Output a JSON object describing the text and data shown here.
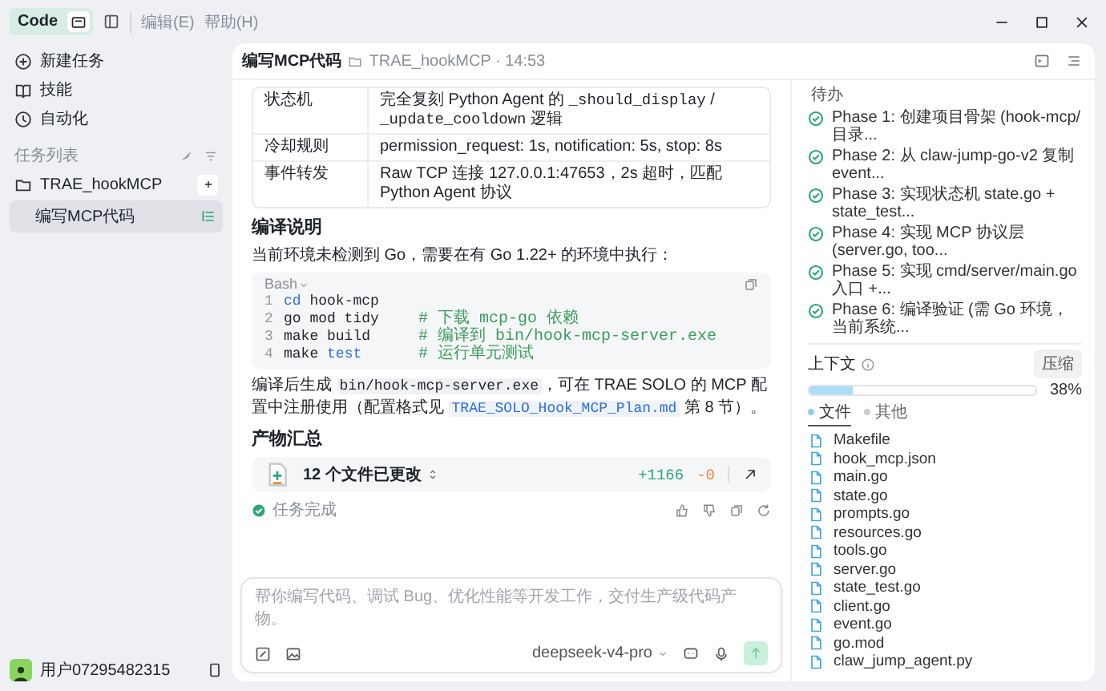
{
  "titlebar": {
    "mode": {
      "label": "Code",
      "on": true
    },
    "menus": [
      "编辑(E)",
      "帮助(H)"
    ]
  },
  "sidebar": {
    "nav": [
      {
        "label": "新建任务",
        "kind": "new"
      },
      {
        "label": "技能",
        "kind": "book"
      },
      {
        "label": "自动化",
        "kind": "clock"
      }
    ],
    "section_title": "任务列表",
    "projects": [
      {
        "name": "TRAE_hookMCP",
        "tasks": [
          {
            "label": "编写MCP代码",
            "selected": true
          }
        ]
      }
    ],
    "user": {
      "name": "用户07295482315"
    }
  },
  "task_header": {
    "title": "编写MCP代码",
    "meta": "TRAE_hookMCP · 14:53"
  },
  "chat": {
    "blocks": [
      {
        "kind": "table",
        "rows": [
          {
            "label": "状态机",
            "value": [
              {
                "kind": "text",
                "text": "完全复刻 Python Agent 的 "
              },
              {
                "kind": "mono",
                "text": "_should_display"
              },
              {
                "kind": "text",
                "text": " / "
              },
              {
                "kind": "mono",
                "text": "_update_cooldown"
              },
              {
                "kind": "text",
                "text": " 逻辑"
              }
            ]
          },
          {
            "label": "冷却规则",
            "value": [
              {
                "kind": "text",
                "text": "permission_request: 1s, notification: 5s, stop: 8s"
              }
            ]
          },
          {
            "label": "事件转发",
            "value": [
              {
                "kind": "text",
                "text": "Raw TCP 连接 127.0.0.1:47653，2s 超时，匹配 Python Agent 协议"
              }
            ]
          }
        ]
      },
      {
        "kind": "heading",
        "text": "编译说明"
      },
      {
        "kind": "paragraph",
        "segments": [
          {
            "kind": "text",
            "text": "当前环境未检测到 Go，需要在有 Go 1.22+ 的环境中执行："
          }
        ]
      },
      {
        "kind": "code",
        "language": "Bash",
        "lines": [
          {
            "number": "1",
            "tokens": [
              {
                "kind": "keyword",
                "text": "cd"
              },
              {
                "kind": "plain",
                "text": " hook-mcp"
              }
            ]
          },
          {
            "number": "2",
            "tokens": [
              {
                "kind": "plain",
                "text": "go mod tidy"
              },
              {
                "kind": "comment",
                "text": "# 下载 mcp-go 依赖"
              }
            ]
          },
          {
            "number": "3",
            "tokens": [
              {
                "kind": "plain",
                "text": "make build"
              },
              {
                "kind": "comment",
                "text": "# 编译到 bin/hook-mcp-server.exe"
              }
            ]
          },
          {
            "number": "4",
            "tokens": [
              {
                "kind": "plain",
                "text": "make "
              },
              {
                "kind": "keyword",
                "text": "test"
              },
              {
                "kind": "comment",
                "text": "# 运行单元测试"
              }
            ]
          }
        ]
      },
      {
        "kind": "paragraph",
        "segments": [
          {
            "kind": "text",
            "text": "编译后生成 "
          },
          {
            "kind": "code",
            "text": "bin/hook-mcp-server.exe"
          },
          {
            "kind": "text",
            "text": "，可在 TRAE SOLO 的 MCP 配置中注册使用（配置格式见 "
          },
          {
            "kind": "link",
            "text": "TRAE_SOLO_Hook_MCP_Plan.md"
          },
          {
            "kind": "text",
            "text": " 第 8 节）。"
          }
        ]
      },
      {
        "kind": "heading",
        "text": "产物汇总"
      },
      {
        "kind": "changes",
        "label": "12 个文件已更改",
        "added": "+1166",
        "removed": "-0"
      },
      {
        "kind": "status",
        "label": "任务完成",
        "done": true
      }
    ]
  },
  "input": {
    "placeholder": "帮你编写代码、调试 Bug、优化性能等开发工作，交付生产级代码产物。",
    "model": "deepseek-v4-pro"
  },
  "panel": {
    "todo": {
      "title": "待办",
      "items": [
        {
          "text": "Phase 1: 创建项目骨架 (hook-mcp/ 目录...",
          "done": true
        },
        {
          "text": "Phase 2: 从 claw-jump-go-v2 复制 event...",
          "done": true
        },
        {
          "text": "Phase 3: 实现状态机 state.go + state_test...",
          "done": true
        },
        {
          "text": "Phase 4: 实现 MCP 协议层 (server.go, too...",
          "done": true
        },
        {
          "text": "Phase 5: 实现 cmd/server/main.go 入口 +...",
          "done": true
        },
        {
          "text": "Phase 6: 编译验证 (需 Go 环境，当前系统...",
          "done": true
        }
      ]
    },
    "context": {
      "title": "上下文",
      "button": "压缩",
      "percent": "38%",
      "level": 0.19,
      "legend": [
        {
          "label": "文件",
          "selected": true,
          "color": "#8fd0f2"
        },
        {
          "label": "其他",
          "selected": false,
          "color": "#c9cdd3"
        }
      ]
    },
    "files": [
      "Makefile",
      "hook_mcp.json",
      "main.go",
      "state.go",
      "prompts.go",
      "resources.go",
      "tools.go",
      "server.go",
      "state_test.go",
      "client.go",
      "event.go",
      "go.mod",
      "claw_jump_agent.py"
    ]
  }
}
